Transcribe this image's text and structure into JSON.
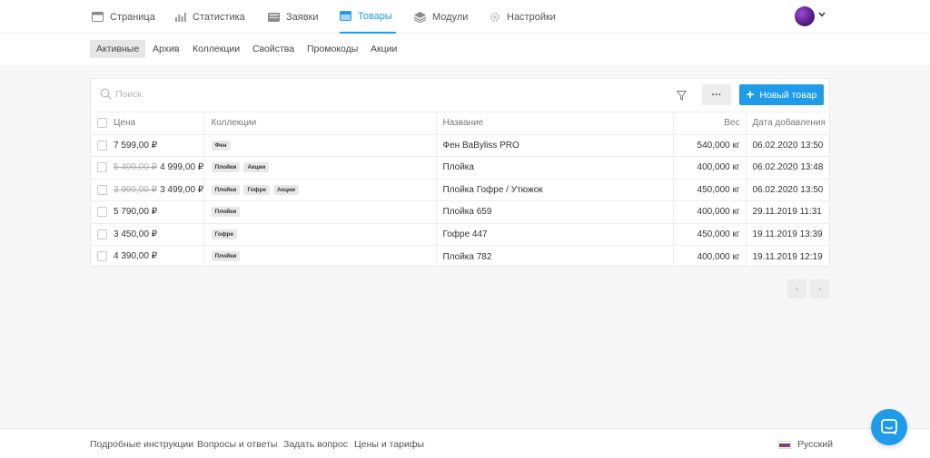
{
  "nav": {
    "items": [
      {
        "label": "Страница",
        "icon": "window-icon"
      },
      {
        "label": "Статистика",
        "icon": "bar-chart-icon"
      },
      {
        "label": "Заявки",
        "icon": "inbox-icon"
      },
      {
        "label": "Товары",
        "icon": "box-icon",
        "active": true
      },
      {
        "label": "Модули",
        "icon": "layers-icon"
      },
      {
        "label": "Настройки",
        "icon": "gear-icon"
      }
    ]
  },
  "subnav": {
    "tabs": [
      "Активные",
      "Архив",
      "Коллекции",
      "Свойства",
      "Промокоды",
      "Акции"
    ],
    "active": "Активные"
  },
  "toolbar": {
    "search_placeholder": "Поиск",
    "more_label": "···",
    "new_label": "Новый товар"
  },
  "table": {
    "headers": {
      "price": "Цена",
      "collections": "Коллекции",
      "name": "Название",
      "weight": "Вес",
      "date": "Дата добавления"
    },
    "rows": [
      {
        "old_price": "",
        "price": "7 599,00 ₽",
        "tags": [
          "Фен"
        ],
        "name": "Фен BaByliss PRO",
        "weight": "540,000 кг",
        "date": "06.02.2020 13:50"
      },
      {
        "old_price": "5 499,00 ₽",
        "price": "4 999,00 ₽",
        "tags": [
          "Плойки",
          "Акции"
        ],
        "name": "Плойка",
        "weight": "400,000 кг",
        "date": "06.02.2020 13:48"
      },
      {
        "old_price": "3 999,00 ₽",
        "price": "3 499,00 ₽",
        "tags": [
          "Плойки",
          "Гофре",
          "Акции"
        ],
        "name": "Плойка Гофре / Утюжок",
        "weight": "450,000 кг",
        "date": "06.02.2020 13:50"
      },
      {
        "old_price": "",
        "price": "5 790,00 ₽",
        "tags": [
          "Плойки"
        ],
        "name": "Плойка 659",
        "weight": "400,000 кг",
        "date": "29.11.2019 11:31"
      },
      {
        "old_price": "",
        "price": "3 450,00 ₽",
        "tags": [
          "Гофре"
        ],
        "name": "Гофре 447",
        "weight": "450,000 кг",
        "date": "19.11.2019 13:39"
      },
      {
        "old_price": "",
        "price": "4 390,00 ₽",
        "tags": [
          "Плойки"
        ],
        "name": "Плойка 782",
        "weight": "400,000 кг",
        "date": "19.11.2019 12:19"
      }
    ]
  },
  "pager": {
    "prev": "‹",
    "next": "›"
  },
  "footer": {
    "links": [
      "Подробные инструкции",
      "Вопросы и ответы",
      "Задать вопрос",
      "Цены и тарифы"
    ],
    "language": "Русский"
  },
  "colors": {
    "accent": "#1e9be9",
    "tag_bg": "#e8e8e8",
    "page_bg": "#f7f7f7"
  }
}
